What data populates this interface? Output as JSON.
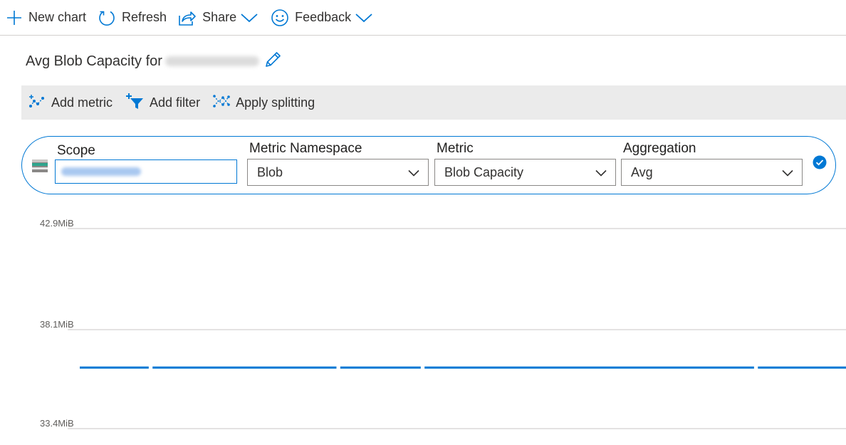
{
  "toolbar": {
    "new_chart": "New chart",
    "refresh": "Refresh",
    "share": "Share",
    "feedback": "Feedback"
  },
  "title": {
    "prefix": "Avg Blob Capacity for"
  },
  "command_bar": {
    "add_metric": "Add metric",
    "add_filter": "Add filter",
    "apply_splitting": "Apply splitting"
  },
  "selector": {
    "scope_label": "Scope",
    "namespace_label": "Metric Namespace",
    "namespace_value": "Blob",
    "metric_label": "Metric",
    "metric_value": "Blob Capacity",
    "aggregation_label": "Aggregation",
    "aggregation_value": "Avg"
  },
  "colors": {
    "accent": "#0078d4",
    "series": "#0078d4",
    "grid": "#c8c6c4"
  },
  "chart_data": {
    "type": "line",
    "y_tick_labels": [
      "42.9MiB",
      "38.1MiB",
      "33.4MiB"
    ],
    "y_ticks": [
      42.9,
      38.1,
      33.4
    ],
    "ylim": [
      33.4,
      42.9
    ],
    "x_range": [
      0,
      100
    ],
    "series": [
      {
        "color": "#0078d4",
        "segments": [
          {
            "x": [
              0,
              9
            ],
            "y": [
              36.3,
              36.3
            ]
          },
          {
            "x": [
              9.5,
              33.5
            ],
            "y": [
              36.3,
              36.3
            ]
          },
          {
            "x": [
              34,
              44.5
            ],
            "y": [
              36.3,
              36.3
            ]
          },
          {
            "x": [
              45,
              88
            ],
            "y": [
              36.3,
              36.3
            ]
          },
          {
            "x": [
              88.5,
              100
            ],
            "y": [
              36.3,
              36.3
            ]
          }
        ]
      }
    ],
    "grid": true,
    "legend": "none"
  }
}
